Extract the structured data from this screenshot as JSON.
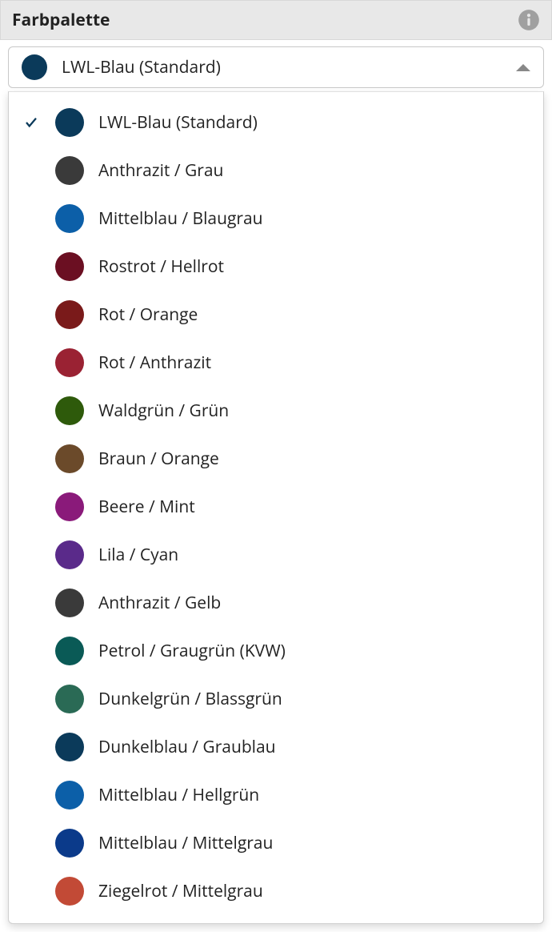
{
  "header": {
    "title": "Farbpalette"
  },
  "select": {
    "selected_label": "LWL-Blau (Standard)",
    "selected_color": "#0b3a5a"
  },
  "options": [
    {
      "label": "LWL-Blau (Standard)",
      "color": "#0b3a5a",
      "selected": true
    },
    {
      "label": "Anthrazit / Grau",
      "color": "#3a3a3a",
      "selected": false
    },
    {
      "label": "Mittelblau / Blaugrau",
      "color": "#0c5fa8",
      "selected": false
    },
    {
      "label": "Rostrot / Hellrot",
      "color": "#6b0f22",
      "selected": false
    },
    {
      "label": "Rot / Orange",
      "color": "#7a1a1a",
      "selected": false
    },
    {
      "label": "Rot / Anthrazit",
      "color": "#9a2233",
      "selected": false
    },
    {
      "label": "Waldgrün / Grün",
      "color": "#2e5a0b",
      "selected": false
    },
    {
      "label": "Braun / Orange",
      "color": "#6b4a2a",
      "selected": false
    },
    {
      "label": "Beere / Mint",
      "color": "#8a1a7a",
      "selected": false
    },
    {
      "label": "Lila / Cyan",
      "color": "#5a2a8a",
      "selected": false
    },
    {
      "label": "Anthrazit / Gelb",
      "color": "#3a3a3a",
      "selected": false
    },
    {
      "label": "Petrol / Graugrün (KVW)",
      "color": "#0a5a56",
      "selected": false
    },
    {
      "label": "Dunkelgrün / Blassgrün",
      "color": "#2a6a55",
      "selected": false
    },
    {
      "label": "Dunkelblau / Graublau",
      "color": "#0b3a5a",
      "selected": false
    },
    {
      "label": "Mittelblau / Hellgrün",
      "color": "#0c5fa8",
      "selected": false
    },
    {
      "label": "Mittelblau / Mittelgrau",
      "color": "#0b3a8a",
      "selected": false
    },
    {
      "label": "Ziegelrot / Mittelgrau",
      "color": "#c24a36",
      "selected": false
    }
  ]
}
